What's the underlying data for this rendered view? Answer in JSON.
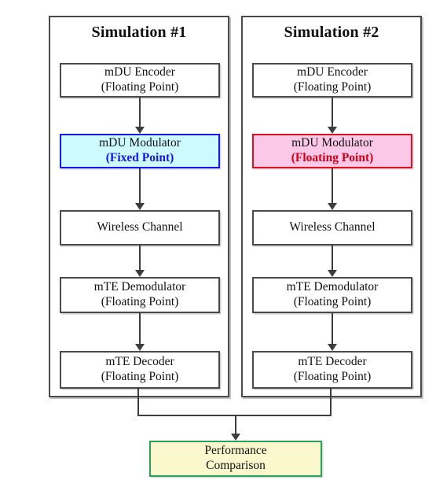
{
  "diagram": {
    "title_visible": false,
    "panels": [
      {
        "id": "simulation-1",
        "title": "Simulation #1",
        "stages": [
          {
            "id": "encoder",
            "line1": "mDU Encoder",
            "line2": "(Floating Point)",
            "style": "plain"
          },
          {
            "id": "modulator",
            "line1": "mDU Modulator",
            "line2": "(Fixed Point)",
            "style": "fixed-point"
          },
          {
            "id": "channel",
            "line1": "Wireless Channel",
            "line2": "",
            "style": "plain"
          },
          {
            "id": "demodulator",
            "line1": "mTE Demodulator",
            "line2": "(Floating Point)",
            "style": "plain"
          },
          {
            "id": "decoder",
            "line1": "mTE Decoder",
            "line2": "(Floating Point)",
            "style": "plain"
          }
        ]
      },
      {
        "id": "simulation-2",
        "title": "Simulation #2",
        "stages": [
          {
            "id": "encoder",
            "line1": "mDU Encoder",
            "line2": "(Floating Point)",
            "style": "plain"
          },
          {
            "id": "modulator",
            "line1": "mDU Modulator",
            "line2": "(Floating Point)",
            "style": "floating-point"
          },
          {
            "id": "channel",
            "line1": "Wireless Channel",
            "line2": "",
            "style": "plain"
          },
          {
            "id": "demodulator",
            "line1": "mTE Demodulator",
            "line2": "(Floating Point)",
            "style": "plain"
          },
          {
            "id": "decoder",
            "line1": "mTE Decoder",
            "line2": "(Floating Point)",
            "style": "plain"
          }
        ]
      }
    ],
    "result": {
      "id": "performance-comparison",
      "line1": "Performance",
      "line2": "Comparison"
    },
    "colors": {
      "fixed_point_fill": "#cdfaff",
      "fixed_point_border": "#1616e8",
      "fixed_point_text": "#1616e8",
      "floating_point_fill": "#fcc8e8",
      "floating_point_border": "#e01020",
      "floating_point_text": "#cc0018",
      "result_fill": "#fbf8ce",
      "result_border": "#2aa35a",
      "default_border": "#4a4a4a",
      "connector": "#3d3d3d",
      "text": "#111111",
      "background": "#ffffff"
    }
  }
}
